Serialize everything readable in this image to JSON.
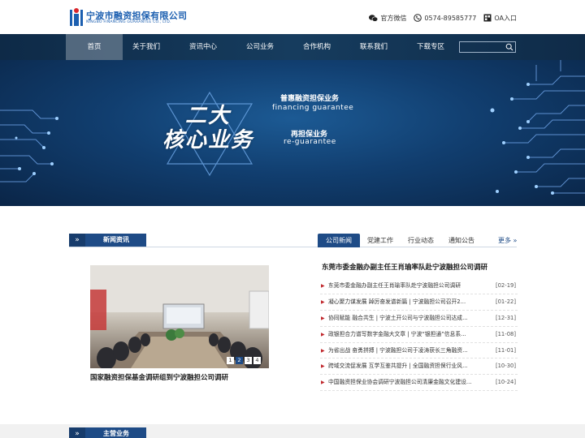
{
  "header": {
    "logo_cn": "宁波市融资担保有限公司",
    "logo_en": "NINGBO FINANCING GUARANTEE CO., LTD.",
    "wechat_label": "官方微信",
    "phone": "0574-89585777",
    "oa_label": "OA入口"
  },
  "nav": {
    "items": [
      {
        "label": "首页",
        "active": true
      },
      {
        "label": "关于我们"
      },
      {
        "label": "资讯中心"
      },
      {
        "label": "公司业务"
      },
      {
        "label": "合作机构"
      },
      {
        "label": "联系我们"
      },
      {
        "label": "下载专区"
      }
    ],
    "search_placeholder": ""
  },
  "banner": {
    "big_line1": "二大",
    "big_line2": "核心业务",
    "service1_cn": "普惠融资担保业务",
    "service1_en": "financing  guarantee",
    "service2_cn": "再担保业务",
    "service2_en": "re-guarantee"
  },
  "news": {
    "section_title": "新闻资讯",
    "tabs": [
      "公司新闻",
      "党建工作",
      "行业动态",
      "通知公告"
    ],
    "active_tab": 0,
    "more_label": "更多 »",
    "image_caption": "国家融资担保基金调研组到宁波融担公司调研",
    "pager": [
      "1",
      "2",
      "3",
      "4"
    ],
    "pager_current": 1,
    "headline": "东莞市委金融办副主任王肖瑜率队赴宁波融担公司调研",
    "items": [
      {
        "title": "东莞市委金融办副主任王肖瑜率队赴宁波融担公司调研",
        "date": "[02-19]"
      },
      {
        "title": "凝心聚力谋发展 踔厉奋发谱新篇 | 宁波融担公司召开2...",
        "date": "[01-22]"
      },
      {
        "title": "协同赋能 融合共生 | 宁波土开公司与宁波融担公司达成...",
        "date": "[12-31]"
      },
      {
        "title": "政银担合力谱写数字金融大文章 | 宁波“银担通”信息系...",
        "date": "[11-08]"
      },
      {
        "title": "为省出战 奋勇拼搏 | 宁波融担公司于凌涛获长三角融资...",
        "date": "[11-01]"
      },
      {
        "title": "跨域交流促发展 互学互鉴共提升 | 全国融资担保行业风...",
        "date": "[10-30]"
      },
      {
        "title": "中国融资担保业协会调研宁波融担公司清廉金融文化建设...",
        "date": "[10-24]"
      }
    ]
  },
  "business": {
    "section_title": "主营业务"
  },
  "colors": {
    "nav_bg": "#163c5e",
    "accent": "#1e4b86",
    "bullet": "#c0282d"
  }
}
